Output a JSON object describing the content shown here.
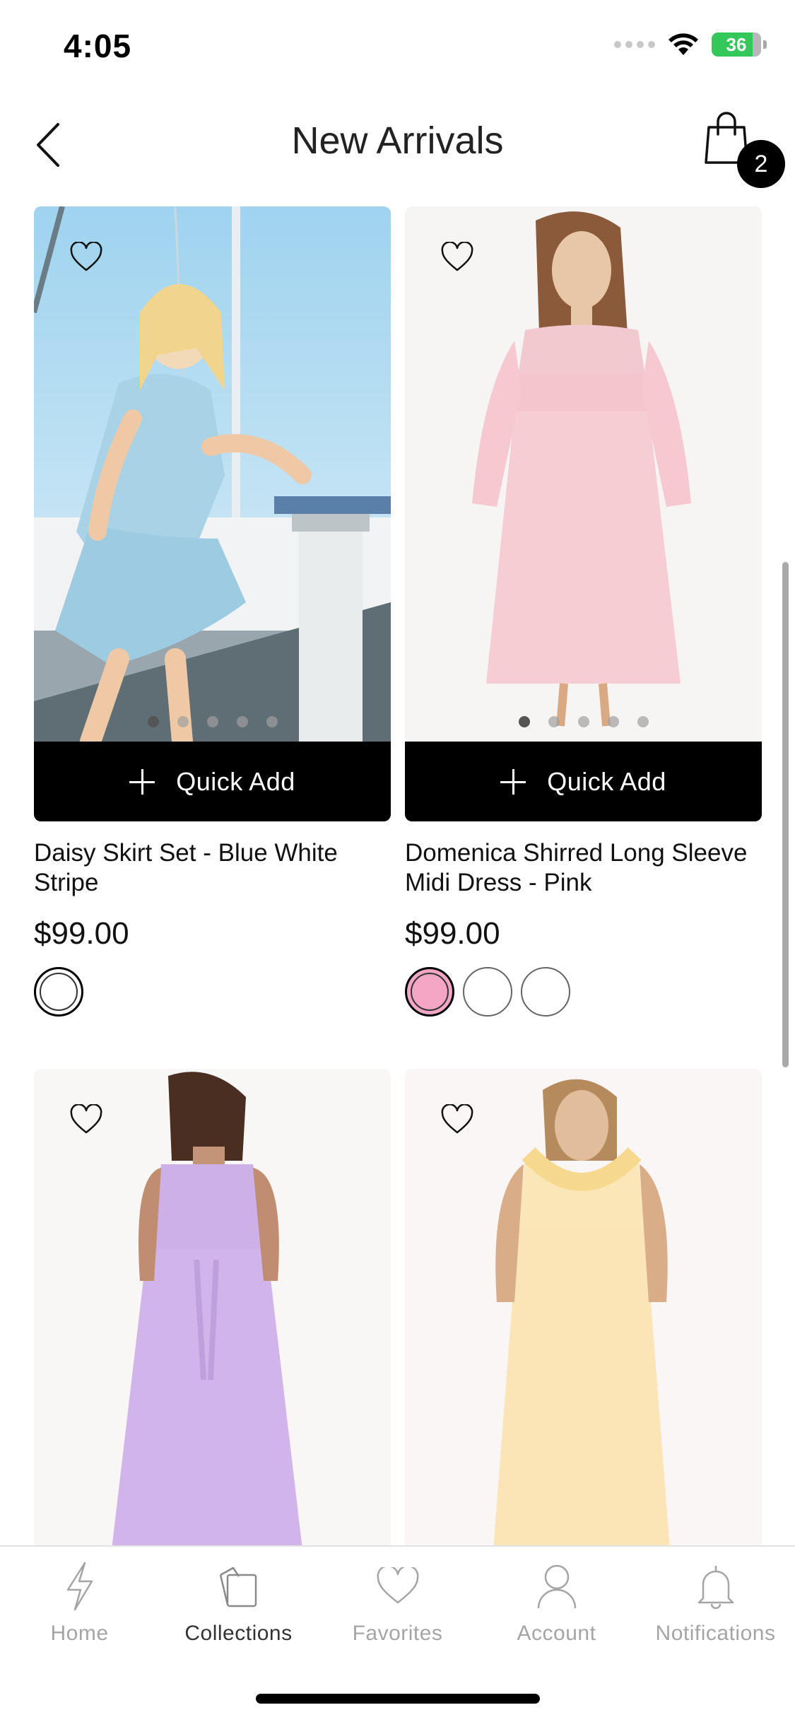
{
  "status_bar": {
    "time": "4:05",
    "battery": "36"
  },
  "header": {
    "title": "New Arrivals",
    "cart_count": "2"
  },
  "products": [
    {
      "name": "Daisy Skirt Set - Blue White Stripe",
      "price": "$99.00",
      "quick_add": "Quick Add",
      "swatches": [
        "#ffffff"
      ],
      "selected_swatch": 0,
      "image_slides": 5,
      "active_slide": 0
    },
    {
      "name": "Domenica Shirred Long Sleeve Midi Dress - Pink",
      "price": "$99.00",
      "quick_add": "Quick Add",
      "swatches": [
        "#f4a6c4",
        "#ffffff",
        "#ffffff"
      ],
      "selected_swatch": 0,
      "image_slides": 5,
      "active_slide": 0
    },
    {
      "name": "",
      "price": ""
    },
    {
      "name": "",
      "price": ""
    }
  ],
  "tab_bar": {
    "tabs": [
      {
        "label": "Home",
        "icon": "lightning-icon",
        "active": false
      },
      {
        "label": "Collections",
        "icon": "collections-icon",
        "active": true
      },
      {
        "label": "Favorites",
        "icon": "heart-icon",
        "active": false
      },
      {
        "label": "Account",
        "icon": "person-icon",
        "active": false
      },
      {
        "label": "Notifications",
        "icon": "bell-icon",
        "active": false
      }
    ]
  },
  "colors": {
    "accent": "#000000",
    "inactive_tab": "#a5a5a5",
    "battery": "#34c759"
  }
}
